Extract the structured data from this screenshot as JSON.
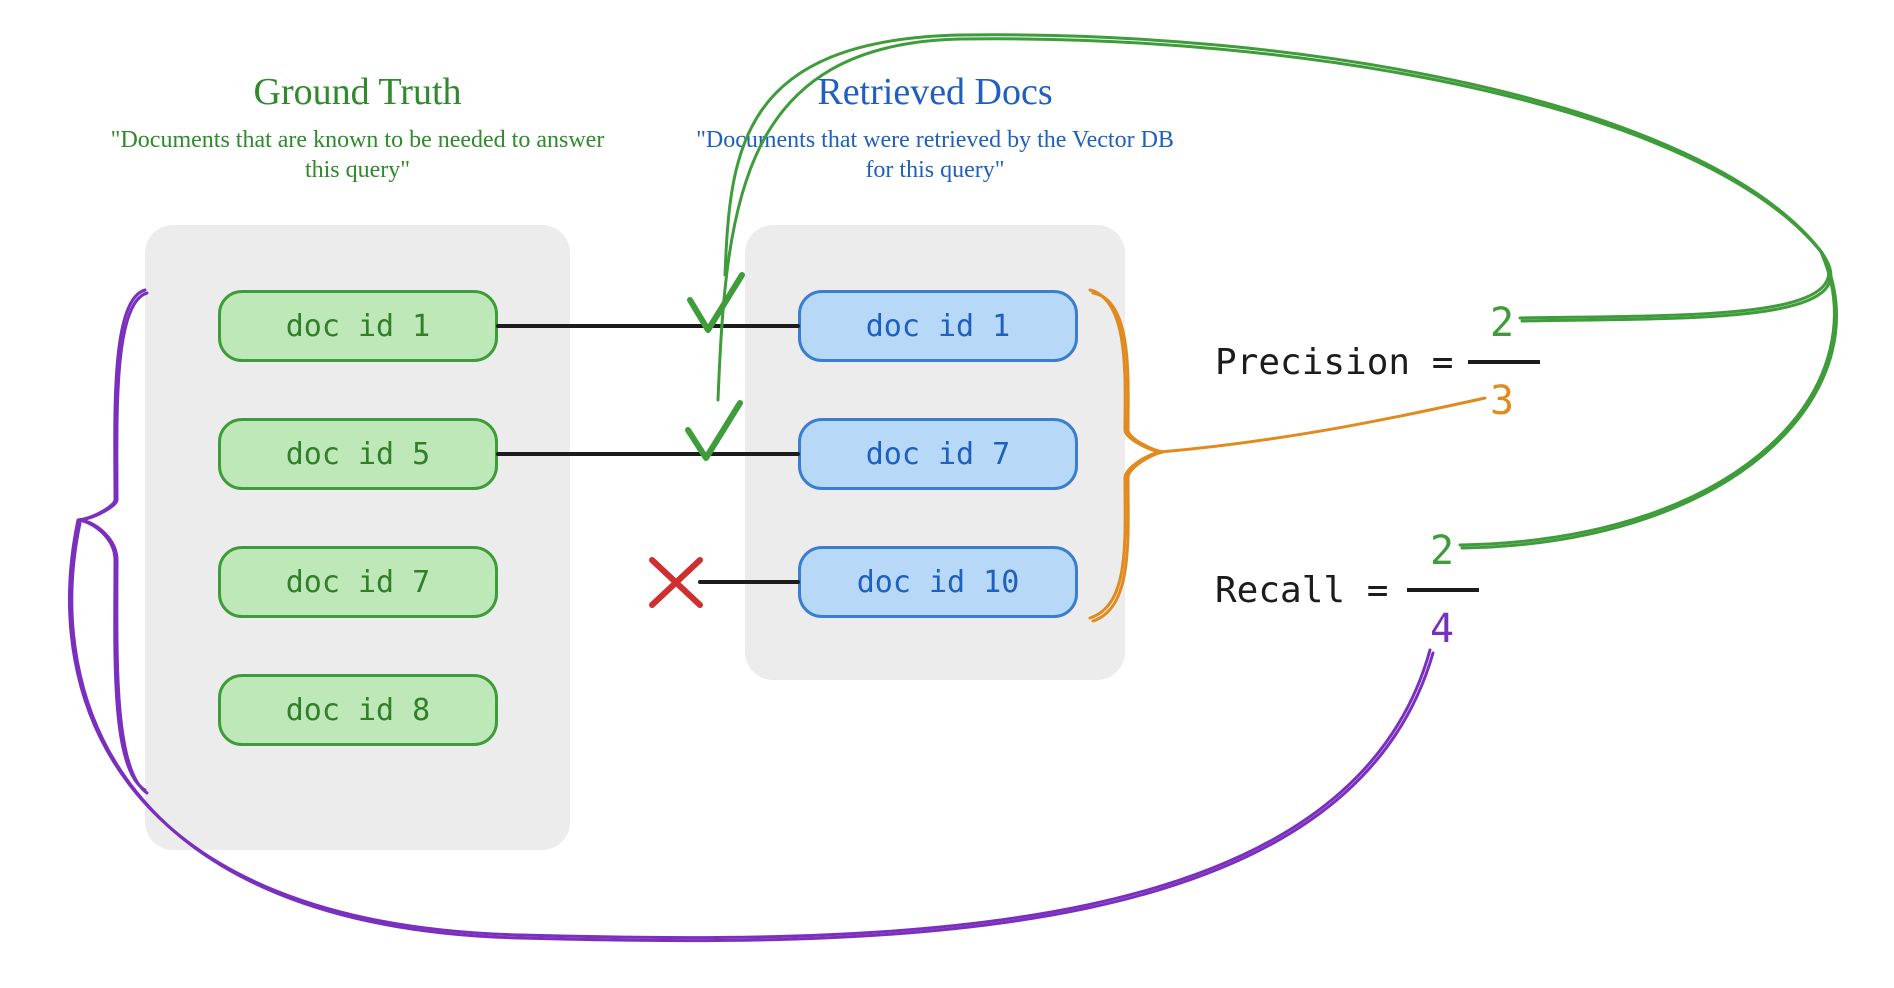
{
  "ground_truth": {
    "title": "Ground Truth",
    "subtitle": "\"Documents that are known to be needed to answer this query\"",
    "docs": [
      "doc id 1",
      "doc id 5",
      "doc id 7",
      "doc id 8"
    ]
  },
  "retrieved": {
    "title": "Retrieved Docs",
    "subtitle": "\"Documents that were retrieved by the Vector DB for this query\"",
    "docs": [
      "doc id 1",
      "doc id 7",
      "doc id 10"
    ]
  },
  "matches": {
    "doc_id_1": true,
    "doc_id_7": true,
    "doc_id_10": false
  },
  "metrics": {
    "precision": {
      "label": "Precision =",
      "numerator": "2",
      "denominator": "3"
    },
    "recall": {
      "label": "Recall =",
      "numerator": "2",
      "denominator": "4"
    }
  },
  "colors": {
    "green": "#3f9c3a",
    "blue": "#1f5fbf",
    "orange": "#e08a1f",
    "purple": "#7a2fbf",
    "red": "#cf2f2f",
    "panel": "#ececec"
  }
}
